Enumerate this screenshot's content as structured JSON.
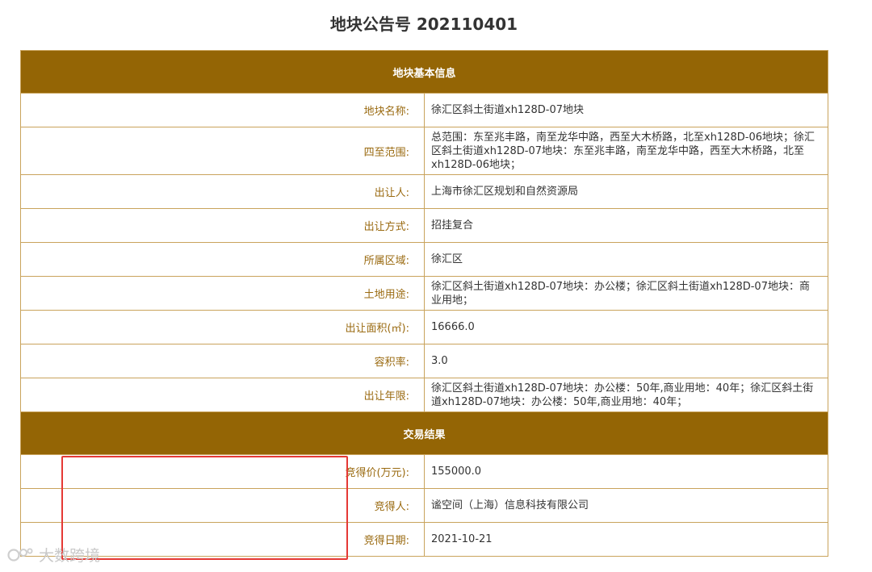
{
  "title": "地块公告号 202110401",
  "basic_info": {
    "heading": "地块基本信息",
    "rows": [
      {
        "label": "地块名称:",
        "value": "徐汇区斜土街道xh128D-07地块"
      },
      {
        "label": "四至范围:",
        "value": "总范围：东至兆丰路，南至龙华中路，西至大木桥路，北至xh128D-06地块；徐汇区斜土街道xh128D-07地块：东至兆丰路，南至龙华中路，西至大木桥路，北至xh128D-06地块；"
      },
      {
        "label": "出让人:",
        "value": "上海市徐汇区规划和自然资源局"
      },
      {
        "label": "出让方式:",
        "value": "招挂复合"
      },
      {
        "label": "所属区域:",
        "value": "徐汇区"
      },
      {
        "label": "土地用途:",
        "value": "徐汇区斜土街道xh128D-07地块：办公楼；徐汇区斜土街道xh128D-07地块：商业用地；"
      },
      {
        "label": "出让面积(㎡):",
        "value": "16666.0"
      },
      {
        "label": "容积率:",
        "value": "3.0"
      },
      {
        "label": "出让年限:",
        "value": "徐汇区斜土街道xh128D-07地块：办公楼：50年,商业用地：40年；徐汇区斜土街道xh128D-07地块：办公楼：50年,商业用地：40年；"
      }
    ]
  },
  "result": {
    "heading": "交易结果",
    "rows": [
      {
        "label": "竞得价(万元):",
        "value": "155000.0"
      },
      {
        "label": "竞得人:",
        "value": "谧空间（上海）信息科技有限公司"
      },
      {
        "label": "竞得日期:",
        "value": "2021-10-21"
      }
    ]
  },
  "watermark": "大数跨境",
  "colors": {
    "header_bg": "#946505",
    "label_text": "#9a6a10",
    "border": "#c9a35c",
    "highlight": "#e53935"
  }
}
